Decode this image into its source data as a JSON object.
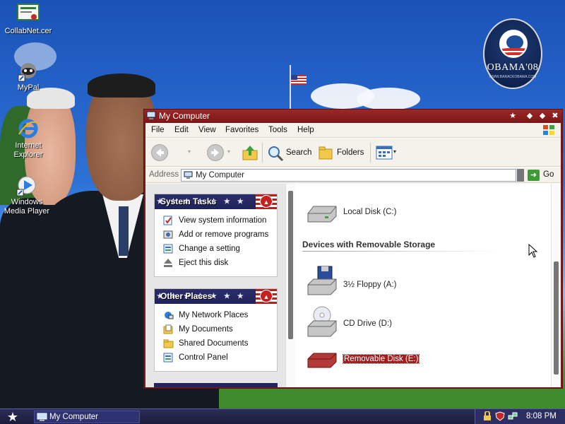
{
  "desktop": {
    "icons": [
      {
        "label": "CollabNet.cer",
        "icon": "certificate-icon"
      },
      {
        "label": "MyPal",
        "icon": "raccoon-shortcut-icon"
      },
      {
        "label": "Internet Explorer",
        "icon": "internet-explorer-icon"
      },
      {
        "label": "Windows Media Player",
        "icon": "windows-media-player-icon"
      }
    ],
    "badge": {
      "text": "OBAMA'08",
      "subtext": "WWW.BARACKOBAMA.COM"
    }
  },
  "window": {
    "title": "My Computer",
    "menu": [
      "File",
      "Edit",
      "View",
      "Favorites",
      "Tools",
      "Help"
    ],
    "toolbar": {
      "search_label": "Search",
      "folders_label": "Folders"
    },
    "address": {
      "label": "Address",
      "value": "My Computer",
      "go_label": "Go"
    },
    "task_panels": [
      {
        "title": "System Tasks",
        "items": [
          {
            "label": "View system information",
            "icon": "system-info-icon"
          },
          {
            "label": "Add or remove programs",
            "icon": "add-remove-programs-icon"
          },
          {
            "label": "Change a setting",
            "icon": "control-panel-icon"
          },
          {
            "label": "Eject this disk",
            "icon": "eject-icon"
          }
        ]
      },
      {
        "title": "Other Places",
        "items": [
          {
            "label": "My Network Places",
            "icon": "network-places-icon"
          },
          {
            "label": "My Documents",
            "icon": "my-documents-icon"
          },
          {
            "label": "Shared Documents",
            "icon": "folder-icon"
          },
          {
            "label": "Control Panel",
            "icon": "control-panel-icon"
          }
        ]
      }
    ],
    "hard_drives": [
      {
        "label": "Local Disk (C:)",
        "icon": "hard-disk-icon"
      }
    ],
    "removable_group": "Devices with Removable Storage",
    "removable": [
      {
        "label": "3½ Floppy (A:)",
        "icon": "floppy-drive-icon"
      },
      {
        "label": "CD Drive (D:)",
        "icon": "cd-drive-icon"
      },
      {
        "label": "Removable Disk (E:)",
        "icon": "removable-disk-icon",
        "selected": true
      }
    ]
  },
  "taskbar": {
    "task_label": "My Computer",
    "clock": "8:08 PM",
    "tray_icons": [
      "security-icon",
      "shield-icon",
      "network-icon"
    ]
  },
  "colors": {
    "title_bar": "#8a1e1e",
    "panel_header": "#23265e",
    "selection": "#a01e1e",
    "taskbar": "#22244a"
  }
}
